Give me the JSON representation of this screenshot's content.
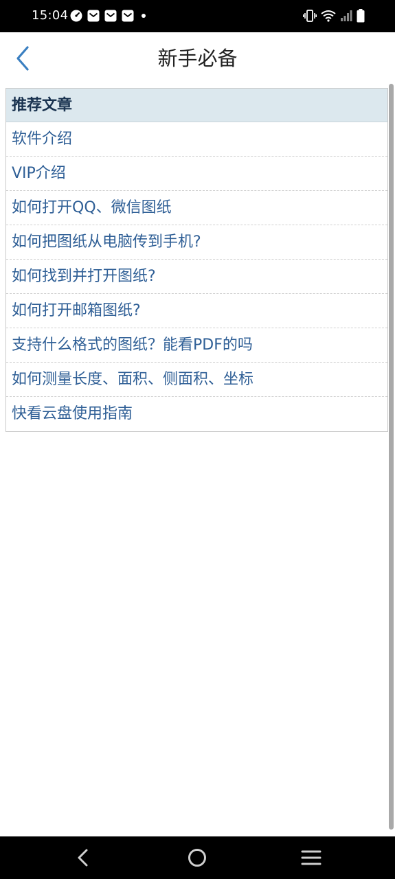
{
  "status_bar": {
    "time": "15:04",
    "left_icons": [
      "speedometer-icon",
      "mail-icon",
      "mail-icon",
      "mail-icon",
      "notification-dot-icon"
    ],
    "right_icons": [
      "vibrate-icon",
      "wifi-icon",
      "signal-icon",
      "battery-icon"
    ]
  },
  "header": {
    "title": "新手必备",
    "back_icon": "chevron-left-icon",
    "accent_color": "#3a7fc1"
  },
  "list": {
    "header": "推荐文章",
    "items": [
      "软件介绍",
      "VIP介绍",
      "如何打开QQ、微信图纸",
      "如何把图纸从电脑传到手机?",
      "如何找到并打开图纸?",
      "如何打开邮箱图纸?",
      "支持什么格式的图纸？能看PDF的吗",
      "如何测量长度、面积、侧面积、坐标",
      "快看云盘使用指南"
    ],
    "header_bg": "#dce8ee",
    "item_color": "#2f5f96"
  },
  "nav_bar": {
    "icons": [
      "back-triangle-icon",
      "home-circle-icon",
      "menu-lines-icon"
    ]
  }
}
